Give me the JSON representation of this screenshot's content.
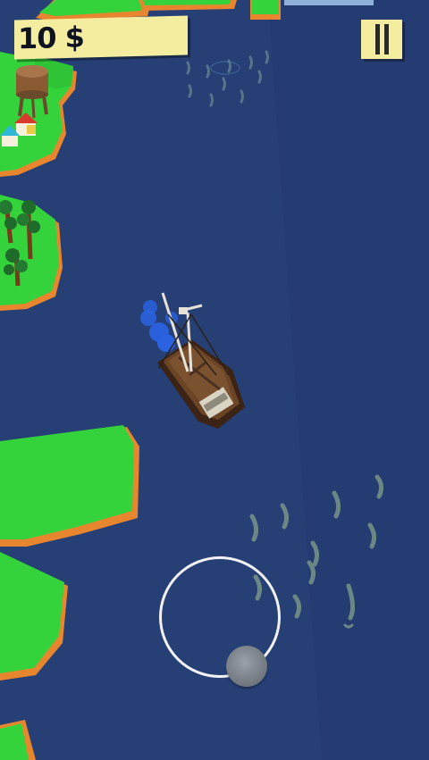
{
  "hud": {
    "money": "10 $"
  },
  "colors": {
    "water": "#263f75",
    "grass": "#35d33b",
    "shore": "#e8862f",
    "hud_panel": "#f4eda0"
  },
  "icons": {
    "pause": "pause-icon",
    "joystick": "virtual-joystick"
  }
}
